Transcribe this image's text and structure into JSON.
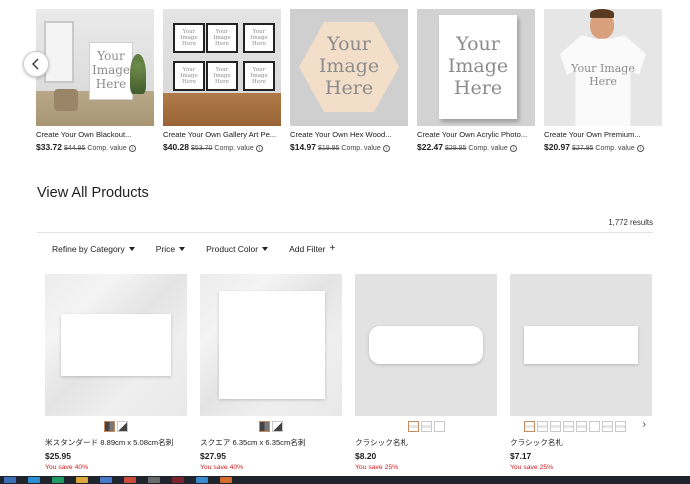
{
  "carousel": {
    "items": [
      {
        "title": "Create Your Own Blackout...",
        "price": "$33.72",
        "was": "$44.95",
        "comp": "Comp. value",
        "image_text": "Your Image Here"
      },
      {
        "title": "Create Your Own Gallery Art Pe...",
        "price": "$40.28",
        "was": "$53.70",
        "comp": "Comp. value",
        "image_text": "Your Image Here"
      },
      {
        "title": "Create Your Own Hex Wood...",
        "price": "$14.97",
        "was": "$19.95",
        "comp": "Comp. value",
        "image_text": "Your Image Here"
      },
      {
        "title": "Create Your Own Acrylic Photo...",
        "price": "$22.47",
        "was": "$29.95",
        "comp": "Comp. value",
        "image_text": "Your Image Here"
      },
      {
        "title": "Create Your Own Premium...",
        "price": "$20.97",
        "was": "$27.95",
        "comp": "Comp. value",
        "image_text": "Your Image Here"
      }
    ],
    "prev_icon": "chevron-left-icon",
    "info_icon": "i"
  },
  "section": {
    "title": "View All Products",
    "results": "1,772 results"
  },
  "filters": [
    {
      "label": "Refine by Category",
      "icon": "caret-down-icon"
    },
    {
      "label": "Price",
      "icon": "caret-down-icon"
    },
    {
      "label": "Product Color",
      "icon": "caret-down-icon"
    },
    {
      "label": "Add Filter",
      "icon": "plus-icon",
      "symbol": "+"
    }
  ],
  "products": [
    {
      "title": "米スタンダード 8.89cm x 5.08cm名刺",
      "price": "$25.95",
      "save": "You save 40%"
    },
    {
      "title": "スクエア 6.35cm x 6.35cm名刺",
      "price": "$27.95",
      "save": "You save 40%"
    },
    {
      "title": "クラシック名札",
      "price": "$8.20",
      "save": "You save 25%"
    },
    {
      "title": "クラシック名札",
      "price": "$7.17",
      "save": "You save 25%"
    }
  ],
  "colors": {
    "save_red": "#d11d1d",
    "swatch_selected": "#c58b5d",
    "taskbar": "#20242d"
  }
}
